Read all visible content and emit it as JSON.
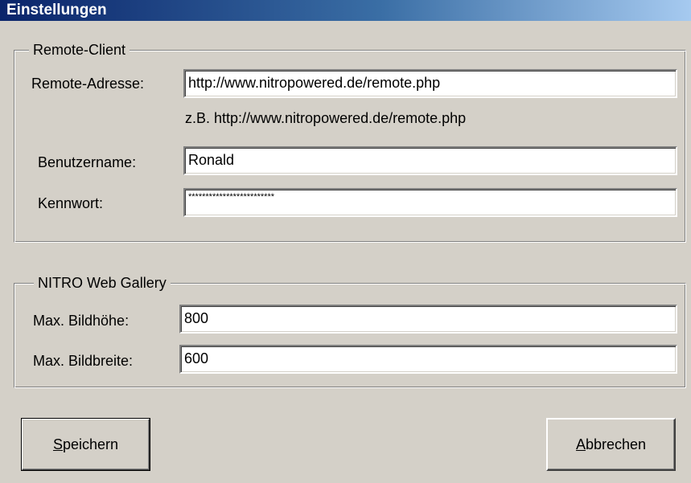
{
  "window": {
    "title": "Einstellungen"
  },
  "remote_client": {
    "legend": "Remote-Client",
    "address_label": "Remote-Adresse:",
    "address_value": "http://www.nitropowered.de/remote.php",
    "address_hint": "z.B. http://www.nitropowered.de/remote.php",
    "username_label": "Benutzername:",
    "username_value": "Ronald",
    "password_label": "Kennwort:",
    "password_value": "*************************"
  },
  "gallery": {
    "legend": "NITRO Web Gallery",
    "max_height_label": "Max. Bildhöhe:",
    "max_height_value": "800",
    "max_width_label": "Max. Bildbreite:",
    "max_width_value": "600"
  },
  "buttons": {
    "save_accel": "S",
    "save_rest": "peichern",
    "cancel_accel": "A",
    "cancel_rest": "bbrechen"
  },
  "colors": {
    "window_bg": "#d4d0c8",
    "title_start": "#0a246a",
    "title_end": "#a6caf0",
    "title_text": "#ffffff"
  }
}
